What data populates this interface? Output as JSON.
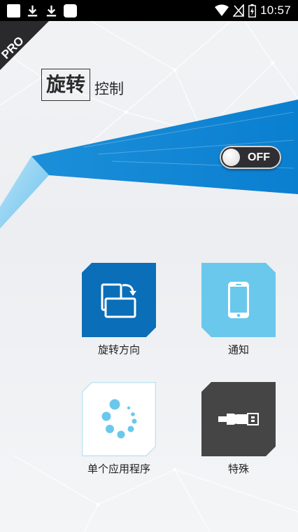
{
  "status_bar": {
    "time": "10:57"
  },
  "badge": {
    "text": "PRO"
  },
  "header": {
    "title_main": "旋转",
    "title_sub": "控制"
  },
  "toggle": {
    "label": "OFF",
    "state": "off"
  },
  "tiles": [
    {
      "label": "旋转方向",
      "icon": "rotate-screen-icon",
      "color": "#0a6eb8"
    },
    {
      "label": "通知",
      "icon": "smartphone-icon",
      "color": "#6ac8ec"
    },
    {
      "label": "单个应用程序",
      "icon": "loading-dots-icon",
      "color": "#ffffff"
    },
    {
      "label": "特殊",
      "icon": "usb-plug-icon",
      "color": "#454545"
    }
  ],
  "colors": {
    "accent": "#0a84d6",
    "beam_light": "#7cc7ef"
  }
}
